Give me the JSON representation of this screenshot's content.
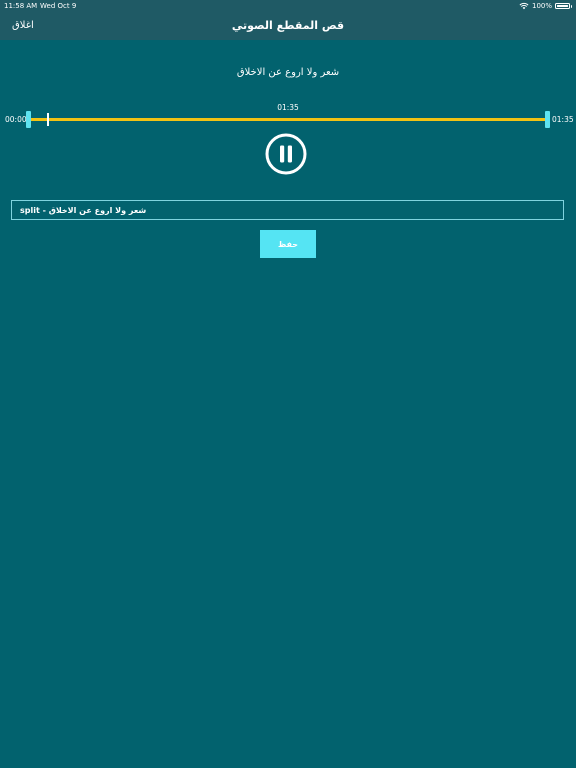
{
  "status_bar": {
    "time": "11:58 AM",
    "date": "Wed Oct 9",
    "battery": "100%"
  },
  "nav": {
    "title": "قص المقطع الصوتي",
    "close_label": "اغلاق"
  },
  "track": {
    "name": "شعر ولا اروع عن الاخلاق",
    "duration": "01:35",
    "start_time": "00:00",
    "end_time": "01:35"
  },
  "name_field": {
    "value": "شعر ولا اروع عن الاخلاق - split"
  },
  "save_label": "حفظ",
  "colors": {
    "background": "#02626e",
    "bar": "#1f5a65",
    "track": "#f2c314",
    "handle": "#5ee3f1",
    "button": "#55e4f3"
  },
  "icons": {
    "pause": "pause-circle-icon",
    "wifi": "wifi-icon",
    "battery": "battery-icon"
  }
}
